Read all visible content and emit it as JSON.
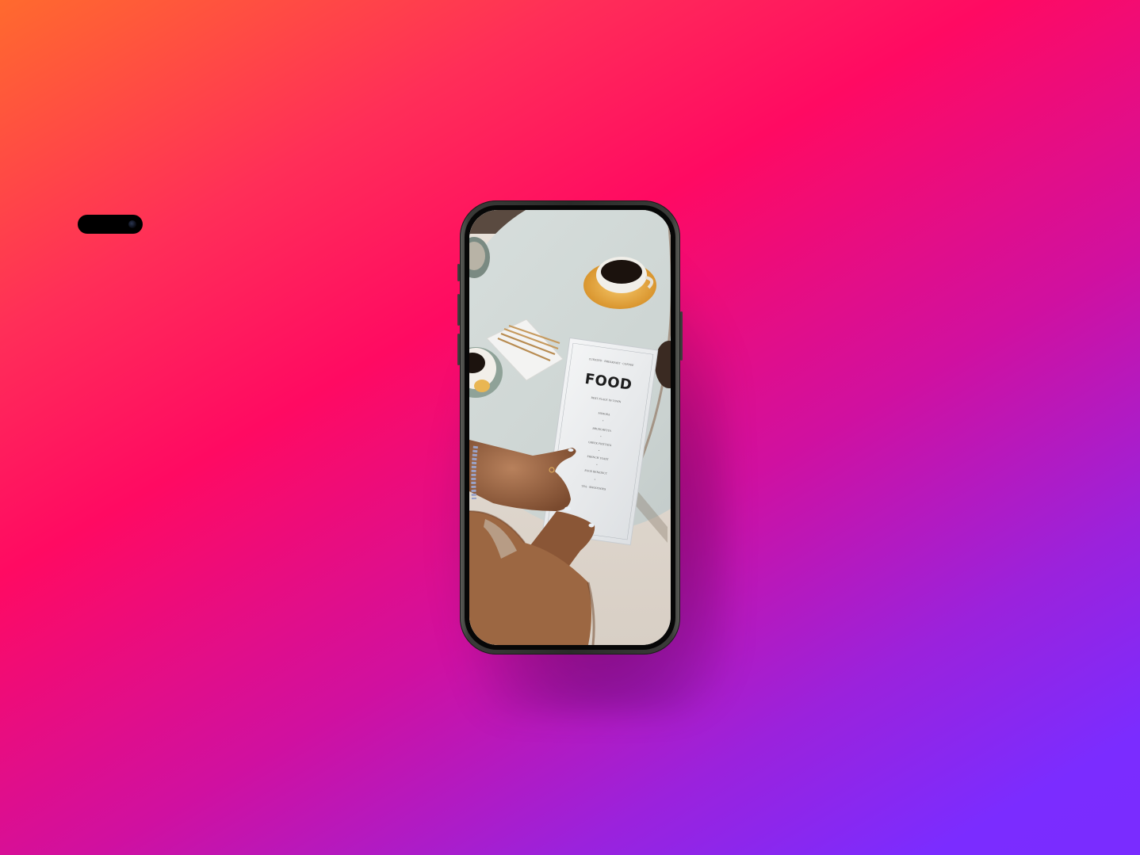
{
  "background": {
    "gradient_colors": [
      "#ff6a2e",
      "#ff0a62",
      "#d010a0",
      "#7b2cff"
    ]
  },
  "phone": {
    "frame_color": "#2a2b29",
    "screen_content": {
      "menu_heading": "FOOD",
      "menu_lines": [
        "CURATED · BREAKFAST · COFFEE",
        "BEST PLACE IN TOWN",
        "MIMOSA",
        "BRUSCHETTA",
        "GREEK FRITTATA",
        "FRENCH TOAST",
        "EGGS BENEDICT",
        "TEA · SMOOTHIES"
      ]
    }
  }
}
